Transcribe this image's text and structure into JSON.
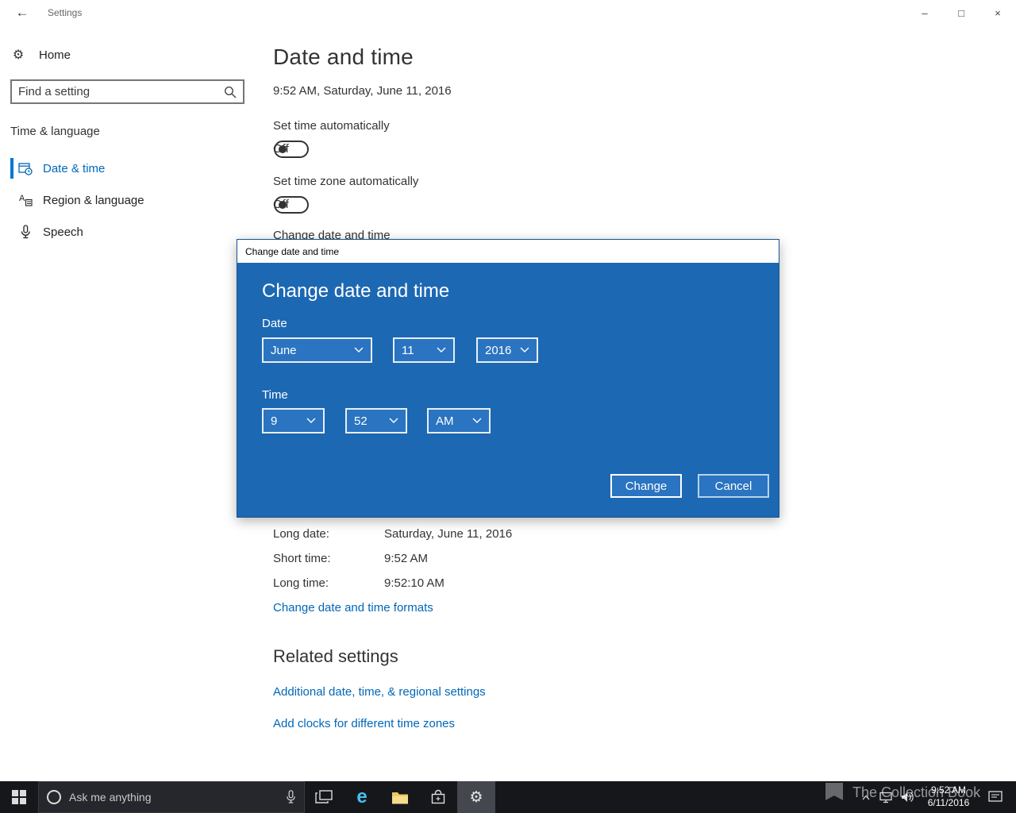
{
  "titlebar": {
    "app_title": "Settings"
  },
  "icons": {
    "back": "←",
    "gear": "⚙",
    "minimize": "–",
    "maximize": "□",
    "close": "×",
    "settings_gear": "⚙",
    "edge": "e",
    "region_a": "A"
  },
  "sidebar": {
    "home_label": "Home",
    "search_placeholder": "Find a setting",
    "section_label": "Time & language",
    "items": [
      {
        "label": "Date & time",
        "selected": true
      },
      {
        "label": "Region & language",
        "selected": false
      },
      {
        "label": "Speech",
        "selected": false
      }
    ]
  },
  "main": {
    "title": "Date and time",
    "current_datetime": "9:52 AM, Saturday, June 11, 2016",
    "set_time_label": "Set time automatically",
    "set_time_state": "Off",
    "set_zone_label": "Set time zone automatically",
    "set_zone_state": "Off",
    "change_heading": "Change date and time",
    "formats": [
      {
        "label": "Long date:",
        "value": "Saturday, June 11, 2016"
      },
      {
        "label": "Short time:",
        "value": "9:52 AM"
      },
      {
        "label": "Long time:",
        "value": "9:52:10 AM"
      }
    ],
    "formats_link": "Change date and time formats",
    "related_title": "Related settings",
    "related_links": [
      "Additional date, time, & regional settings",
      "Add clocks for different time zones"
    ]
  },
  "dialog": {
    "window_title": "Change date and time",
    "heading": "Change date and time",
    "date_label": "Date",
    "month": "June",
    "day": "11",
    "year": "2016",
    "time_label": "Time",
    "hour": "9",
    "minute": "52",
    "ampm": "AM",
    "change_label": "Change",
    "cancel_label": "Cancel"
  },
  "taskbar": {
    "search_placeholder": "Ask me anything",
    "time": "9:52 AM",
    "date": "6/11/2016"
  },
  "watermark": "The Collection Book",
  "colors": {
    "accent": "#0078d7",
    "dialog_bg": "#1d68b3",
    "link": "#0067b8",
    "taskbar_bg": "#16171b"
  }
}
